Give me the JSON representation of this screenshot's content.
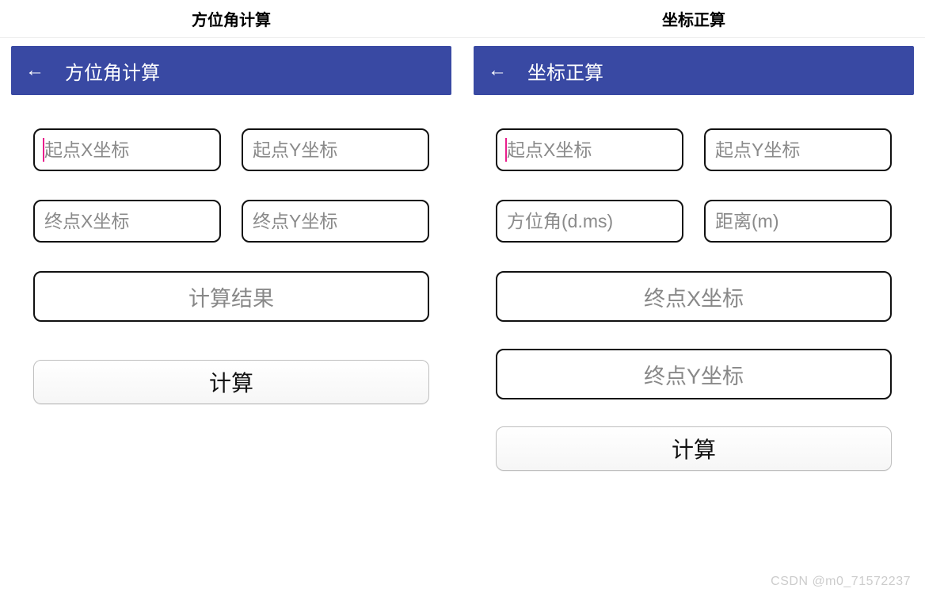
{
  "left": {
    "tab_title": "方位角计算",
    "appbar_title": "方位角计算",
    "inputs": {
      "start_x": "起点X坐标",
      "start_y": "起点Y坐标",
      "end_x": "终点X坐标",
      "end_y": "终点Y坐标"
    },
    "result_placeholder": "计算结果",
    "compute_label": "计算"
  },
  "right": {
    "tab_title": "坐标正算",
    "appbar_title": "坐标正算",
    "inputs": {
      "start_x": "起点X坐标",
      "start_y": "起点Y坐标",
      "azimuth": "方位角(d.ms)",
      "distance": "距离(m)"
    },
    "result_x_placeholder": "终点X坐标",
    "result_y_placeholder": "终点Y坐标",
    "compute_label": "计算"
  },
  "watermark": "CSDN @m0_71572237"
}
